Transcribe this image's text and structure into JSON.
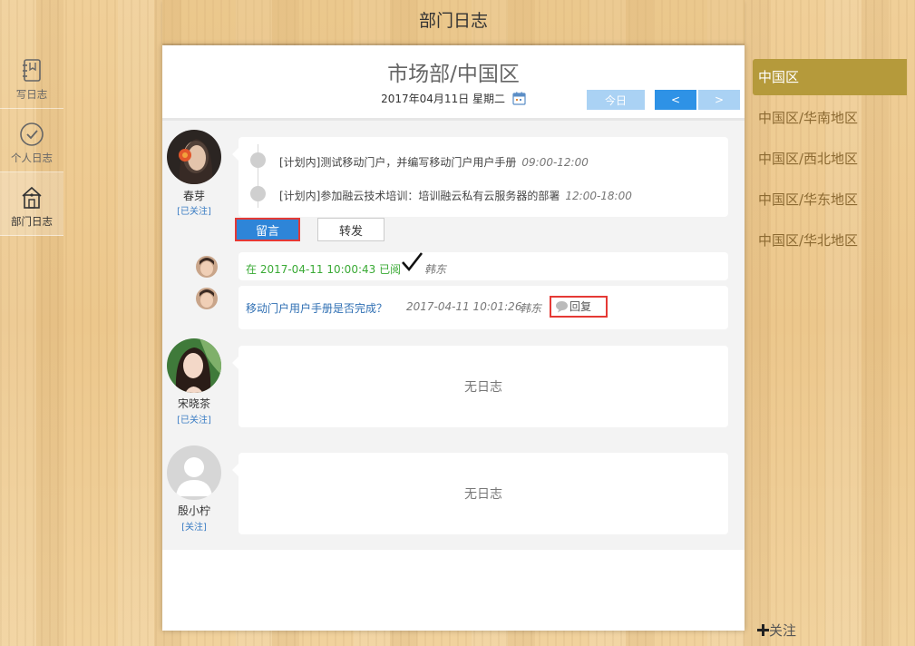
{
  "header": {
    "title": "部门日志"
  },
  "leftnav": {
    "items": [
      {
        "label": "写日志",
        "icon": "notebook-icon"
      },
      {
        "label": "个人日志",
        "icon": "clock-icon"
      },
      {
        "label": "部门日志",
        "icon": "house-icon"
      }
    ]
  },
  "main": {
    "title": "市场部/中国区",
    "date": "2017年04月11日 星期二",
    "today_label": "今日",
    "prev_label": "<",
    "next_label": ">",
    "users": [
      {
        "name": "春芽",
        "follow": "[已关注]",
        "plans": [
          {
            "text": "[计划内]测试移动门户，并编写移动门户用户手册",
            "time": "09:00-12:00"
          },
          {
            "text": "[计划内]参加融云技术培训：培训融云私有云服务器的部署",
            "time": "12:00-18:00"
          }
        ],
        "msg_label": "留言",
        "fwd_label": "转发",
        "read": {
          "text": "在 2017-04-11 10:00:43 已阅",
          "by": "韩东"
        },
        "comment": {
          "text": "移动门户用户手册是否完成？",
          "time": "2017-04-11 10:01:26",
          "by": "韩东",
          "reply_label": "回复"
        }
      },
      {
        "name": "宋晓茶",
        "follow": "[已关注]",
        "empty": "无日志"
      },
      {
        "name": "殷小柠",
        "follow": "[关注]",
        "empty": "无日志"
      }
    ]
  },
  "rightpanel": {
    "items": [
      "中国区",
      "中国区/华南地区",
      "中国区/西北地区",
      "中国区/华东地区",
      "中国区/华北地区"
    ],
    "follow_label": "关注"
  },
  "colors": {
    "accent": "#2e85d8",
    "active_region": "#b59a3b",
    "highlight_border": "#e53935",
    "read_green": "#3aaa35"
  }
}
